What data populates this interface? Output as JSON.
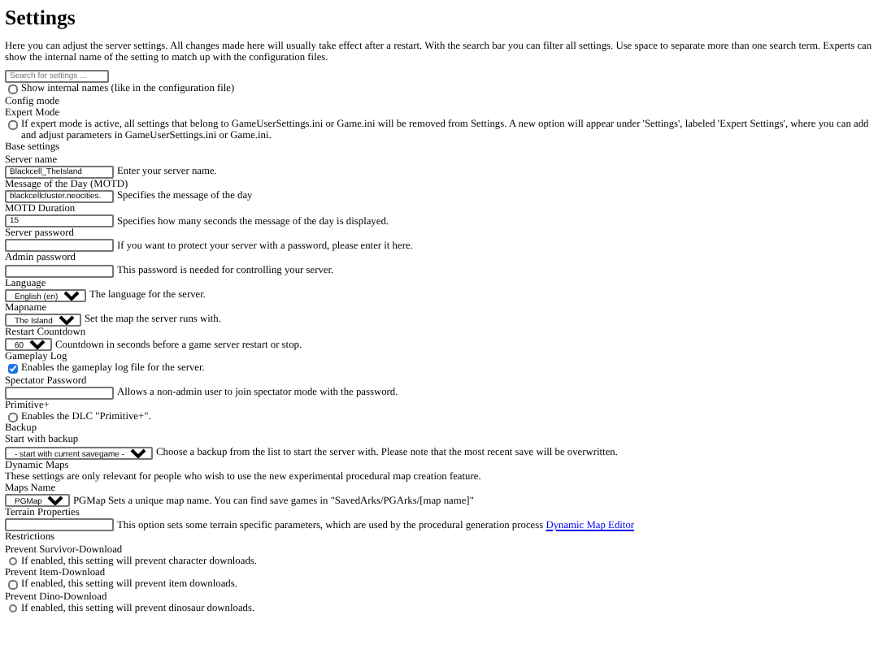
{
  "title": "Settings",
  "intro": "Here you can adjust the server settings. All changes made here will usually take effect after a restart. With the search bar you can filter all settings. Use space to separate more than one search term. Experts can show the internal name of the setting to match up with the configuration files.",
  "search": {
    "placeholder": "Search for settings ..."
  },
  "items": [
    {
      "kind": "check",
      "checked": false,
      "description": "Show internal names (like in the configuration file)"
    },
    {
      "kind": "section",
      "text": "Config mode"
    },
    {
      "kind": "label",
      "text": "Expert Mode"
    },
    {
      "kind": "check",
      "checked": false,
      "description": "If expert mode is active, all settings that belong to GameUserSettings.ini or Game.ini will be removed from Settings. A new option will appear under 'Settings', labeled 'Expert Settings', where you can add and adjust parameters in GameUserSettings.ini or Game.ini."
    },
    {
      "kind": "section",
      "text": "Base settings"
    },
    {
      "kind": "label",
      "text": "Server name"
    },
    {
      "kind": "text_field",
      "value": "Blackcell_TheIsland",
      "description": "Enter your server name."
    },
    {
      "kind": "label",
      "text": "Message of the Day (MOTD)"
    },
    {
      "kind": "text_field",
      "value": "blackcellcluster.neocities.",
      "description": "Specifies the message of the day"
    },
    {
      "kind": "label",
      "text": "MOTD Duration"
    },
    {
      "kind": "text_field",
      "value": "15",
      "description": "Specifies how many seconds the message of the day is displayed."
    },
    {
      "kind": "label",
      "text": "Server password"
    },
    {
      "kind": "text_field",
      "description": "If you want to protect your server with a password, please enter it here."
    },
    {
      "kind": "label",
      "text": "Admin password"
    },
    {
      "kind": "text_field",
      "description": "This password is needed for controlling your server."
    },
    {
      "kind": "label",
      "text": "Language"
    },
    {
      "kind": "select_field",
      "value": "English (en)",
      "description": "The language for the server."
    },
    {
      "kind": "label",
      "text": "Mapname"
    },
    {
      "kind": "select_field",
      "value": "The Island",
      "description": "Set the map the server runs with."
    },
    {
      "kind": "label",
      "text": "Restart Countdown"
    },
    {
      "kind": "select_field",
      "value": "60",
      "description": "Countdown in seconds before a game server restart or stop."
    },
    {
      "kind": "label",
      "text": "Gameplay Log"
    },
    {
      "kind": "check",
      "checked": true,
      "description": "Enables the gameplay log file for the server."
    },
    {
      "kind": "label",
      "text": "Spectator Password"
    },
    {
      "kind": "text_field",
      "description": "Allows a non-admin user to join spectator mode with the password."
    },
    {
      "kind": "label",
      "text": "Primitive+"
    },
    {
      "kind": "check",
      "checked": false,
      "description": "Enables the DLC \"Primitive+\"."
    },
    {
      "kind": "section",
      "text": "Backup"
    },
    {
      "kind": "label",
      "text": "Start with backup"
    },
    {
      "kind": "select_field",
      "value": "- start with current savegame -",
      "description": "Choose a backup from the list to start the server with. Please note that the most recent save will be overwritten."
    },
    {
      "kind": "section",
      "text": "Dynamic Maps"
    },
    {
      "kind": "paragraph",
      "text": "These settings are only relevant for people who wish to use the new experimental procedural map creation feature."
    },
    {
      "kind": "label",
      "text": "Maps Name"
    },
    {
      "kind": "select_field",
      "value": "PGMap",
      "description": "PGMap Sets a unique map name. You can find save games in \"SavedArks/PGArks/[map name]\""
    },
    {
      "kind": "label",
      "text": "Terrain Properties"
    },
    {
      "kind": "text_field",
      "description": "This option sets some terrain specific parameters, which are used by the procedural generation process",
      "link": "Dynamic Map Editor"
    },
    {
      "kind": "section",
      "text": "Restrictions"
    },
    {
      "kind": "label",
      "text": "Prevent Survivor-Download"
    },
    {
      "kind": "check",
      "checked": false,
      "description": "If enabled, this setting will prevent character downloads."
    },
    {
      "kind": "label",
      "text": "Prevent Item-Download"
    },
    {
      "kind": "check",
      "checked": false,
      "description": "If enabled, this setting will prevent item downloads."
    },
    {
      "kind": "label",
      "text": "Prevent Dino-Download"
    },
    {
      "kind": "check",
      "checked": false,
      "description": "If enabled, this setting will prevent dinosaur downloads."
    }
  ]
}
